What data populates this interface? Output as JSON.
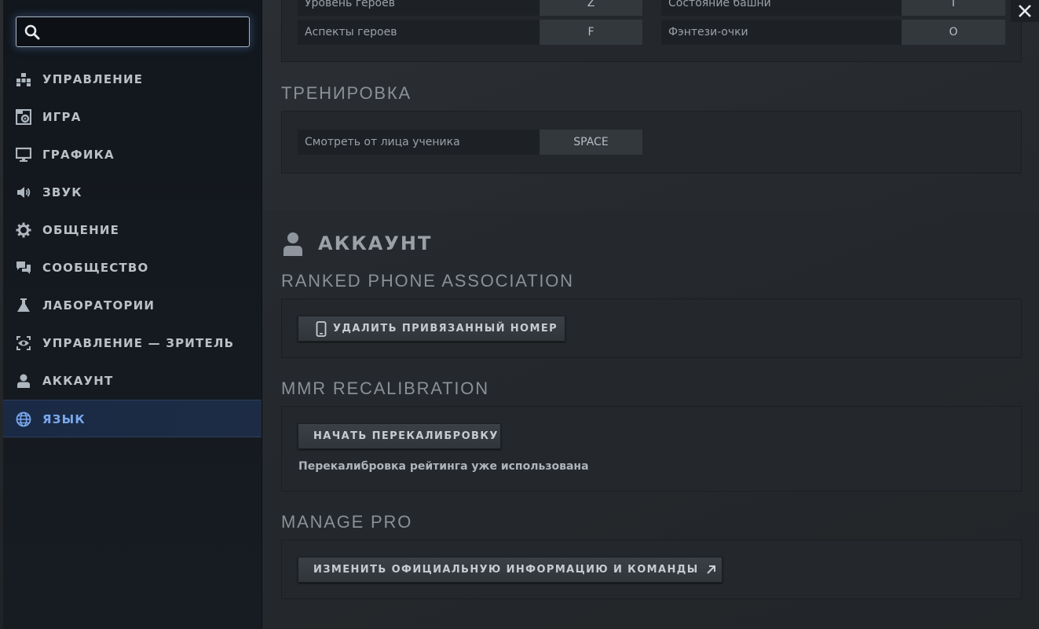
{
  "search": {
    "value": "",
    "placeholder": ""
  },
  "sidebar": {
    "items": [
      {
        "label": "УПРАВЛЕНИЕ",
        "icon": "controls-grid-icon"
      },
      {
        "label": "ИГРА",
        "icon": "game-gear-icon"
      },
      {
        "label": "ГРАФИКА",
        "icon": "monitor-icon"
      },
      {
        "label": "ЗВУК",
        "icon": "speaker-icon"
      },
      {
        "label": "ОБЩЕНИЕ",
        "icon": "gear-icon"
      },
      {
        "label": "СООБЩЕСТВО",
        "icon": "chat-bubbles-icon"
      },
      {
        "label": "ЛАБОРАТОРИИ",
        "icon": "flask-icon"
      },
      {
        "label": "УПРАВЛЕНИЕ — ЗРИТЕЛЬ",
        "icon": "eye-icon"
      },
      {
        "label": "АККАУНТ",
        "icon": "user-icon"
      },
      {
        "label": "ЯЗЫК",
        "icon": "globe-icon",
        "active": true
      }
    ]
  },
  "keybinds_top": {
    "rows": [
      {
        "left_label": "Уровень героев",
        "left_key": "Z",
        "right_label": "Состояние башни",
        "right_key": "I"
      },
      {
        "left_label": "Аспекты героев",
        "left_key": "F",
        "right_label": "Фэнтези-очки",
        "right_key": "O"
      }
    ]
  },
  "training": {
    "heading": "ТРЕНИРОВКА",
    "binding": {
      "label": "Смотреть от лица ученика",
      "key": "SPACE"
    }
  },
  "account": {
    "title": "АККАУНТ",
    "ranked_phone": {
      "heading": "RANKED PHONE ASSOCIATION",
      "button": "УДАЛИТЬ ПРИВЯЗАННЫЙ НОМЕР"
    },
    "mmr": {
      "heading": "MMR RECALIBRATION",
      "button": "НАЧАТЬ ПЕРЕКАЛИБРОВКУ",
      "note": "Перекалибровка рейтинга уже использована"
    },
    "manage_pro": {
      "heading": "MANAGE PRO",
      "button": "ИЗМЕНИТЬ ОФИЦИАЛЬНУЮ ИНФОРМАЦИЮ И КОМАНДЫ"
    }
  },
  "colors": {
    "active_nav": "#7aa8ee",
    "sidebar_bg": "#141920",
    "main_bg": "#2b2f33",
    "button_bg": "#3a4046"
  }
}
